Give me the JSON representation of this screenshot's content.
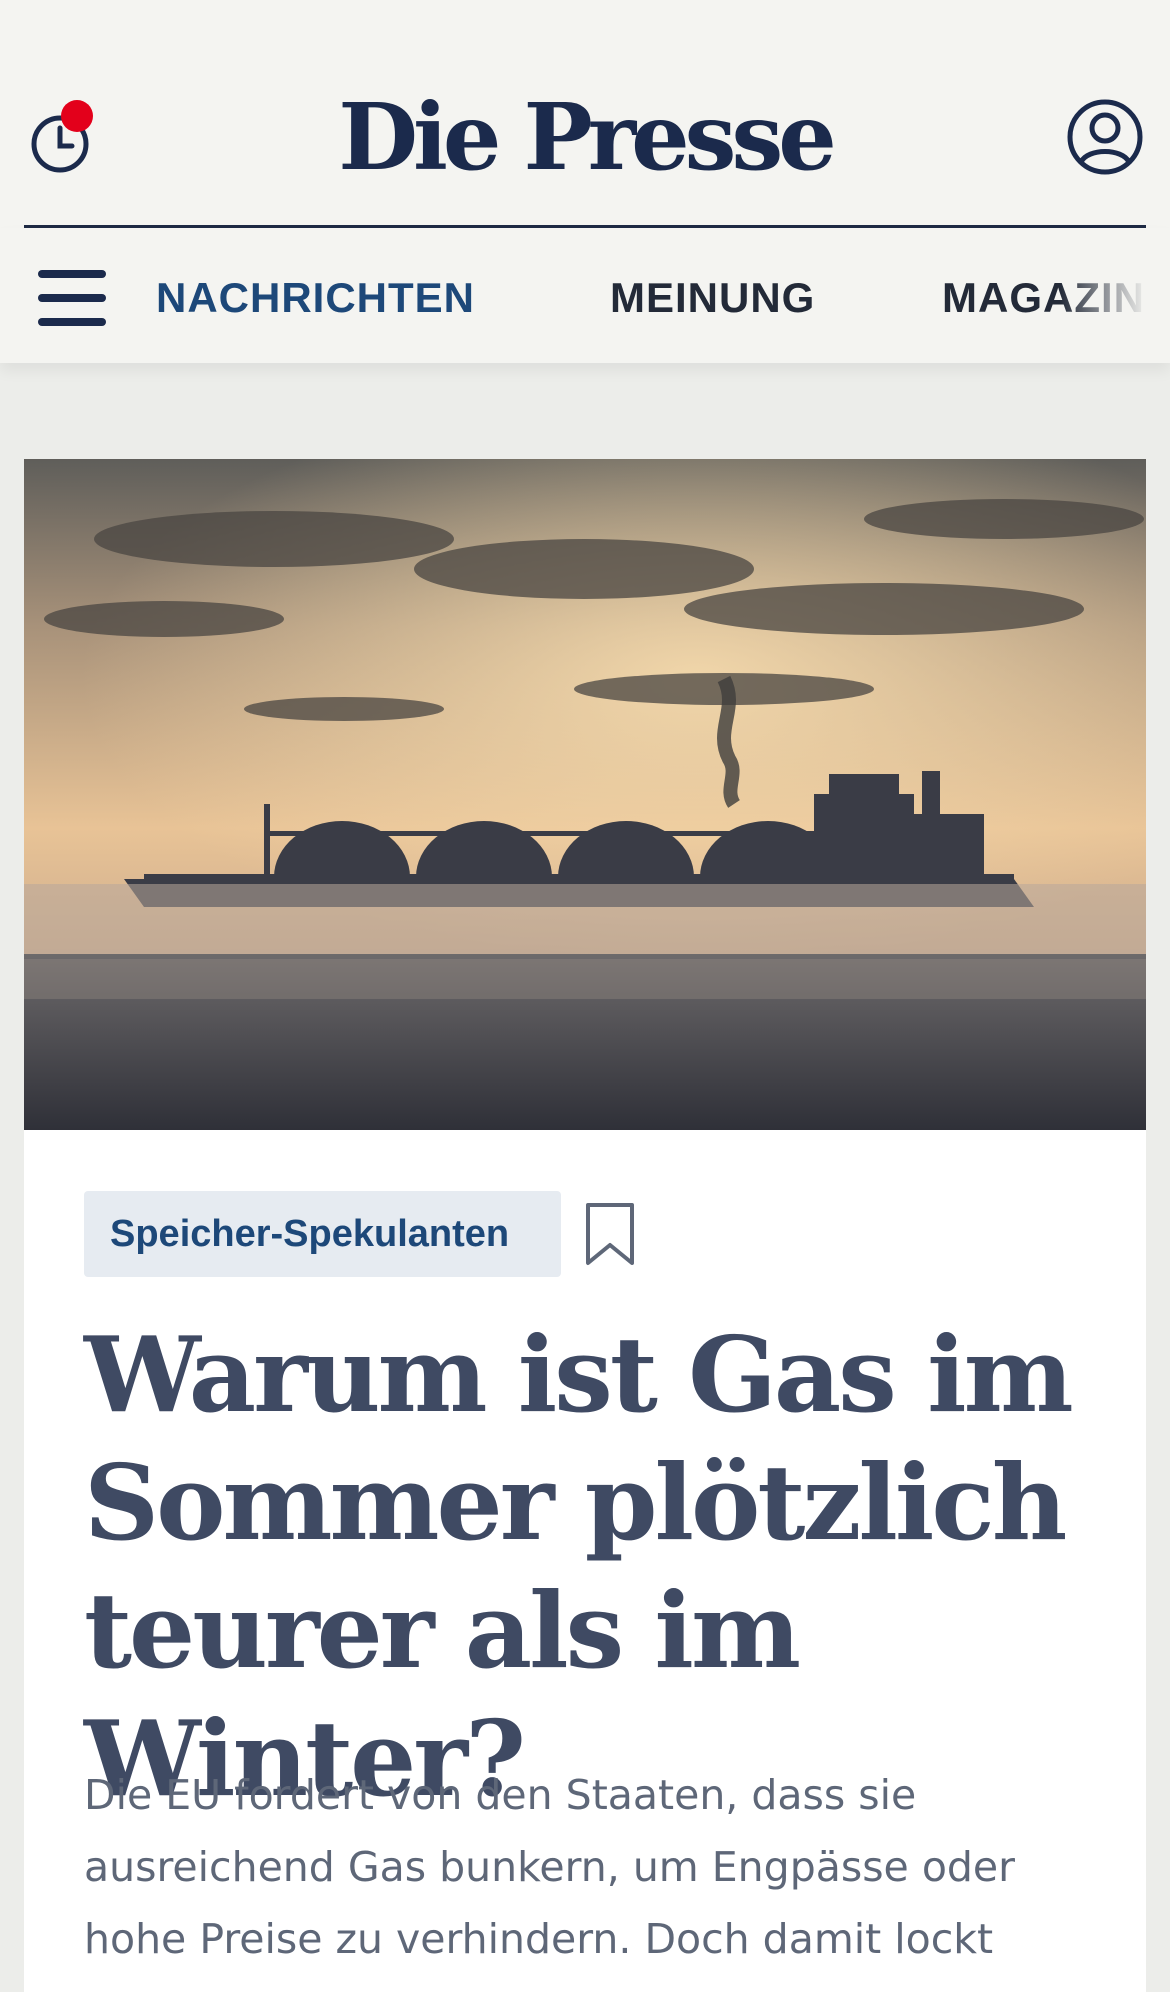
{
  "header": {
    "logo": "Die Presse",
    "history_icon": "clock-icon",
    "account_icon": "user-circle-icon",
    "notification": true,
    "notification_color": "#e3001b"
  },
  "nav": {
    "menu_icon": "hamburger-icon",
    "items": [
      {
        "label": "NACHRICHTEN",
        "active": true
      },
      {
        "label": "MEINUNG",
        "active": false
      },
      {
        "label": "MAGAZIN",
        "active": false
      }
    ]
  },
  "article": {
    "kicker": "Speicher-Spekulanten",
    "bookmark_icon": "bookmark-icon",
    "headline": "Warum ist Gas im Sommer plötzlich teurer als im Winter?",
    "lead": "Die EU fordert von den Staaten, dass sie ausreichend Gas bunkern, um Engpässe oder hohe Preise zu verhindern. Doch damit lockt"
  },
  "colors": {
    "brand_navy": "#1b2a4c",
    "nav_active": "#1d4879",
    "page_bg": "#ecedea",
    "kicker_bg": "#e6ebf1",
    "headline": "#3f4a63"
  }
}
